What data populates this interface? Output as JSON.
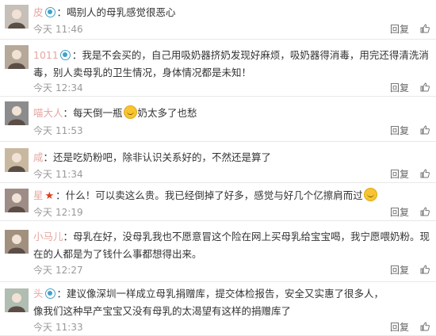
{
  "comments": [
    {
      "name": "皮",
      "vip": true,
      "star": false,
      "text_before": "喝别人的母乳感觉很恶心",
      "emoji": false,
      "text_after": "",
      "text_line2": "",
      "date": "今天",
      "time": "11:46",
      "reply": "回复",
      "like_icon": "thumbs-up-icon"
    },
    {
      "name": "1011",
      "vip": true,
      "star": false,
      "text_before": "我是不会买的，自己用吸奶器挤奶发现好麻烦，吸奶器得消毒，用完还得清洗消",
      "emoji": false,
      "text_after": "",
      "text_line2": "毒，别人卖母乳的卫生情况，身体情况都是未知！",
      "date": "今天",
      "time": "12:34",
      "reply": "回复",
      "like_icon": "thumbs-up-icon"
    },
    {
      "name": "喵大人",
      "vip": false,
      "star": false,
      "text_before": "每天倒一瓶",
      "emoji": true,
      "text_after": "奶太多了也愁",
      "text_line2": "",
      "date": "今天",
      "time": "11:53",
      "reply": "回复",
      "like_icon": "thumbs-up-icon"
    },
    {
      "name": "咸",
      "vip": false,
      "star": false,
      "text_before": "还是吃奶粉吧，除非认识关系好的，不然还是算了",
      "emoji": false,
      "text_after": "",
      "text_line2": "",
      "date": "今天",
      "time": "11:34",
      "reply": "回复",
      "like_icon": "thumbs-up-icon"
    },
    {
      "name": "星",
      "vip": false,
      "star": true,
      "text_before": "什么！可以卖这么贵。我已经倒掉了好多，感觉与好几个亿擦肩而过",
      "emoji": true,
      "text_after": "",
      "text_line2": "",
      "date": "今天",
      "time": "12:19",
      "reply": "回复",
      "like_icon": "thumbs-up-icon"
    },
    {
      "name": "小马儿",
      "vip": false,
      "star": false,
      "text_before": "母乳在好，没母乳我也不愿意冒这个险在网上买母乳给宝宝喝，我宁愿喂奶粉。现",
      "emoji": false,
      "text_after": "",
      "text_line2": "在的人都是为了钱什么事都想得出来。",
      "date": "今天",
      "time": "12:27",
      "reply": "回复",
      "like_icon": "thumbs-up-icon"
    },
    {
      "name": "头",
      "vip": true,
      "star": false,
      "text_before": "建议像深圳一样成立母乳捐赠库，提交体检报告，安全又实惠了很多人，",
      "emoji": false,
      "text_after": "",
      "text_line2": "像我们这种早产宝宝又没有母乳的太渴望有这样的捐赠库了",
      "date": "今天",
      "time": "11:33",
      "reply": "回复",
      "like_icon": "thumbs-up-icon"
    }
  ]
}
